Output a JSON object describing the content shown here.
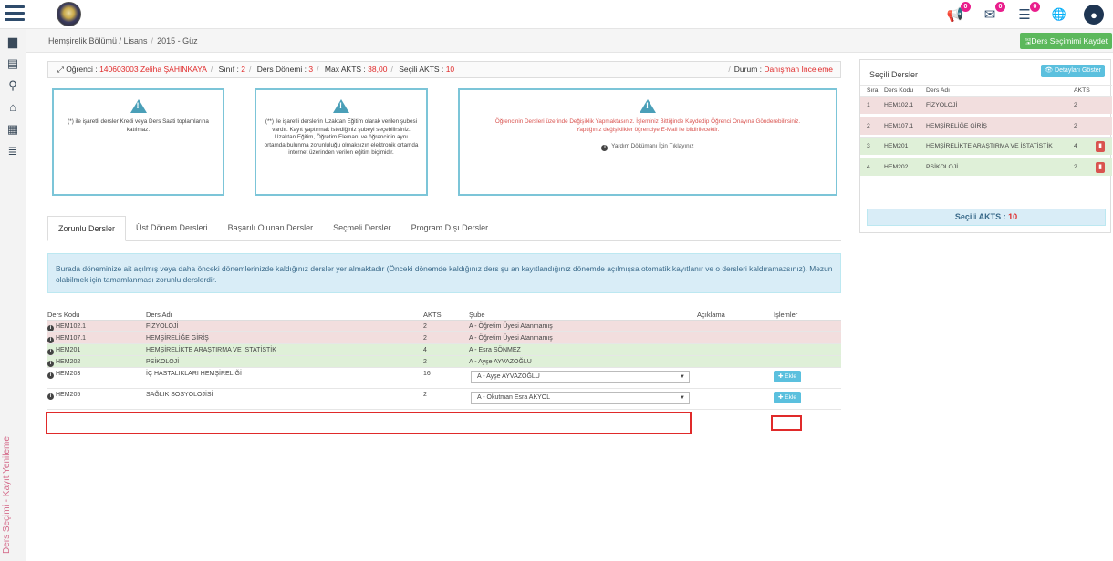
{
  "breadcrumb": {
    "items": [
      "Hemşirelik Bölümü / Lisans",
      "2015 - Güz"
    ]
  },
  "save_button": "Ders Seçimimi Kaydet",
  "badges": {
    "notifications": "0",
    "messages": "0",
    "tasks": "0"
  },
  "student_info": {
    "student_label": "Öğrenci :",
    "student_value": "140603003 Zeliha ŞAHİNKAYA",
    "class_label": "Sınıf :",
    "class_value": "2",
    "term_label": "Ders Dönemi :",
    "term_value": "3",
    "max_akts_label": "Max AKTS :",
    "max_akts_value": "38,00",
    "selected_akts_label": "Seçili AKTS :",
    "selected_akts_value": "10",
    "status_label": "Durum :",
    "status_value": "Danışman İnceleme"
  },
  "info_boxes": {
    "box1": "(*) ile işaretli dersler Kredi veya Ders Saati toplamlarına katılmaz.",
    "box2": "(**) ile işaretli derslerin Uzaktan Eğitim olarak verilen şubesi vardır. Kayıt yaptırmak istediğiniz şubeyi seçebilirsiniz. Uzaktan Eğitim, Öğretim Elemanı ve öğrencinin aynı ortamda bulunma zorunluluğu olmaksızın elektronik ortamda internet üzerinden verilen eğitim biçimidir.",
    "box3_line1": "Öğrencinin Dersleri üzerinde Değişiklik Yapmaktasınız. İşleminiz Bittiğinde Kaydedip Öğrenci Onayına Gönderebilirsiniz.",
    "box3_line2": "Yaptığınız değişiklikler öğrenciye E-Mail ile bildirilecektir.",
    "box3_help": "Yardım Dökümanı İçin Tıklayınız"
  },
  "tabs": [
    "Zorunlu Dersler",
    "Üst Dönem Dersleri",
    "Başarılı Olunan Dersler",
    "Seçmeli Dersler",
    "Program Dışı Dersler"
  ],
  "notice": "Burada döneminize ait açılmış veya daha önceki dönemlerinizde kaldığınız dersler yer almaktadır (Önceki dönemde kaldığınız ders şu an kayıtlandığınız dönemde açılmışsa otomatik kayıtlanır ve o dersleri kaldıramazsınız). Mezun olabilmek için tamamlanması zorunlu derslerdir.",
  "table": {
    "headers": [
      "Ders Kodu",
      "Ders Adı",
      "AKTS",
      "Şube",
      "Açıklama",
      "İşlemler"
    ],
    "rows": [
      {
        "code": "HEM102.1",
        "name": "FİZYOLOJİ",
        "akts": "2",
        "section": "A - Öğretim Üyesi Atanmamış"
      },
      {
        "code": "HEM107.1",
        "name": "HEMŞİRELİĞE GİRİŞ",
        "akts": "2",
        "section": "A - Öğretim Üyesi Atanmamış"
      },
      {
        "code": "HEM201",
        "name": "HEMŞİRELİKTE ARAŞTIRMA VE İSTATİSTİK",
        "akts": "4",
        "section": "A - Esra SÖNMEZ"
      },
      {
        "code": "HEM202",
        "name": "PSİKOLOJİ",
        "akts": "2",
        "section": "A - Ayşe AYVAZOĞLU"
      },
      {
        "code": "HEM203",
        "name": "İÇ HASTALIKLARI HEMŞİRELİĞİ",
        "akts": "16",
        "section": "A - Ayşe AYVAZOĞLU",
        "action": "Ekle"
      },
      {
        "code": "HEM205",
        "name": "SAĞLIK SOSYOLOJİSİ",
        "akts": "2",
        "section": "A - Okutman Esra AKYOL",
        "action": "Ekle"
      }
    ]
  },
  "selected_panel": {
    "title": "Seçili Dersler",
    "details_button": "Detayları Göster",
    "headers": [
      "Sıra",
      "Ders Kodu",
      "Ders Adı",
      "AKTS"
    ],
    "rows": [
      {
        "no": "1",
        "code": "HEM102.1",
        "name": "FİZYOLOJİ",
        "akts": "2"
      },
      {
        "no": "2",
        "code": "HEM107.1",
        "name": "HEMŞİRELİĞE GİRİŞ",
        "akts": "2"
      },
      {
        "no": "3",
        "code": "HEM201",
        "name": "HEMŞİRELİKTE ARAŞTIRMA VE İSTATİSTİK",
        "akts": "4"
      },
      {
        "no": "4",
        "code": "HEM202",
        "name": "PSİKOLOJİ",
        "akts": "2"
      }
    ],
    "total_label": "Seçili AKTS :",
    "total_value": "10"
  },
  "sidebar_vertical_text": "Ders Seçimi - Kayıt Yenileme"
}
